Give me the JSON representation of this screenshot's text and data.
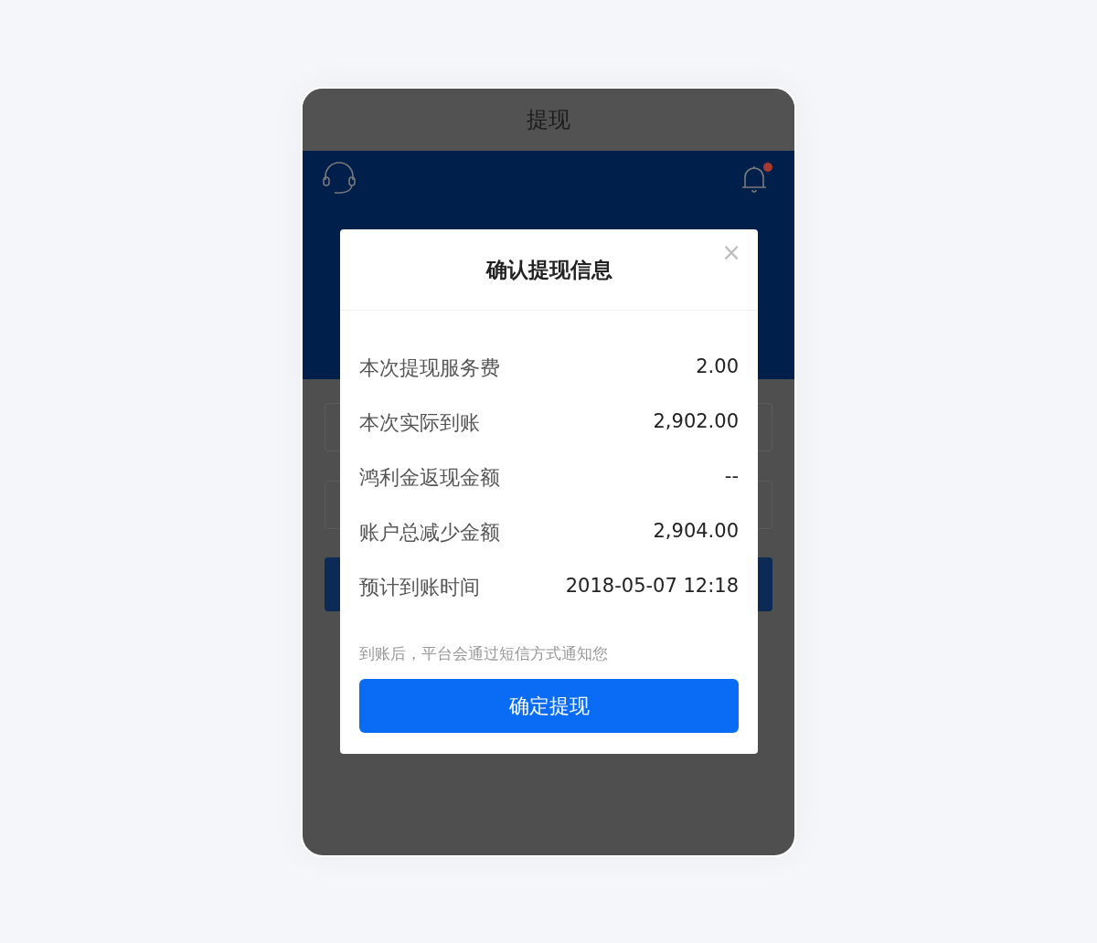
{
  "page_title": "提现",
  "header": {
    "bell_unread": true
  },
  "modal": {
    "title": "确认提现信息",
    "close": "×",
    "rows": [
      {
        "label": "本次提现服务费",
        "value": "2.00"
      },
      {
        "label": "本次实际到账",
        "value": "2,902.00"
      },
      {
        "label": "鸿利金返现金额",
        "value": "--"
      },
      {
        "label": "账户总减少金额",
        "value": "2,904.00"
      },
      {
        "label": "预计到账时间",
        "value": "2018-05-07 12:18"
      }
    ],
    "note": "到账后，平台会通过短信方式通知您",
    "confirm_button": "确定提现"
  }
}
